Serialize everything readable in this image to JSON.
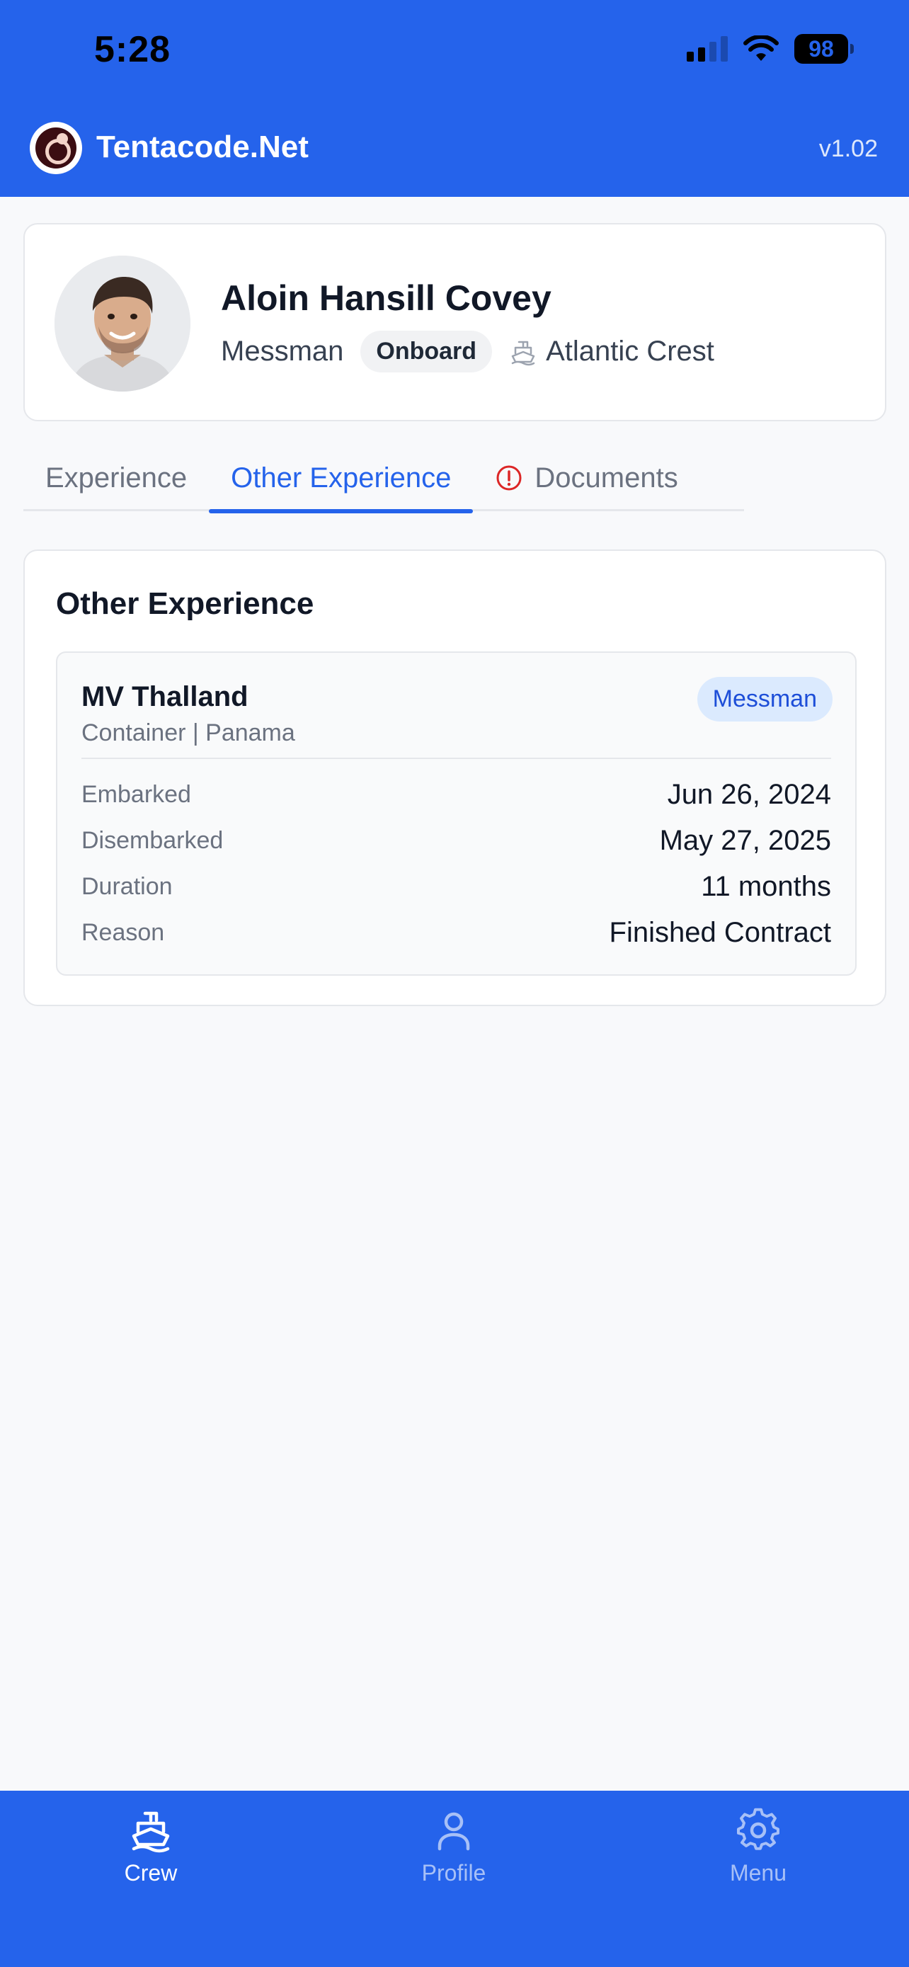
{
  "status_bar": {
    "time": "5:28",
    "battery": "98"
  },
  "app": {
    "title": "Tentacode.Net",
    "version": "v1.02"
  },
  "profile": {
    "name": "Aloin Hansill Covey",
    "rank": "Messman",
    "status": "Onboard",
    "vessel": "Atlantic Crest"
  },
  "tabs": [
    {
      "label": "Experience",
      "active": false
    },
    {
      "label": "Other Experience",
      "active": true
    },
    {
      "label": "Documents",
      "active": false,
      "warning": true
    }
  ],
  "section": {
    "title": "Other Experience"
  },
  "experience": {
    "ship": "MV Thalland",
    "subtitle": "Container | Panama",
    "role": "Messman",
    "rows": [
      {
        "label": "Embarked",
        "value": "Jun 26, 2024"
      },
      {
        "label": "Disembarked",
        "value": "May 27, 2025"
      },
      {
        "label": "Duration",
        "value": "11 months"
      },
      {
        "label": "Reason",
        "value": "Finished Contract"
      }
    ]
  },
  "bottom_nav": [
    {
      "label": "Crew",
      "icon": "ship-icon",
      "active": true
    },
    {
      "label": "Profile",
      "icon": "user-icon",
      "active": false
    },
    {
      "label": "Menu",
      "icon": "gear-icon",
      "active": false
    }
  ],
  "colors": {
    "primary": "#2563eb",
    "warning": "#dc2626",
    "badge_bg": "#dbeafe"
  }
}
